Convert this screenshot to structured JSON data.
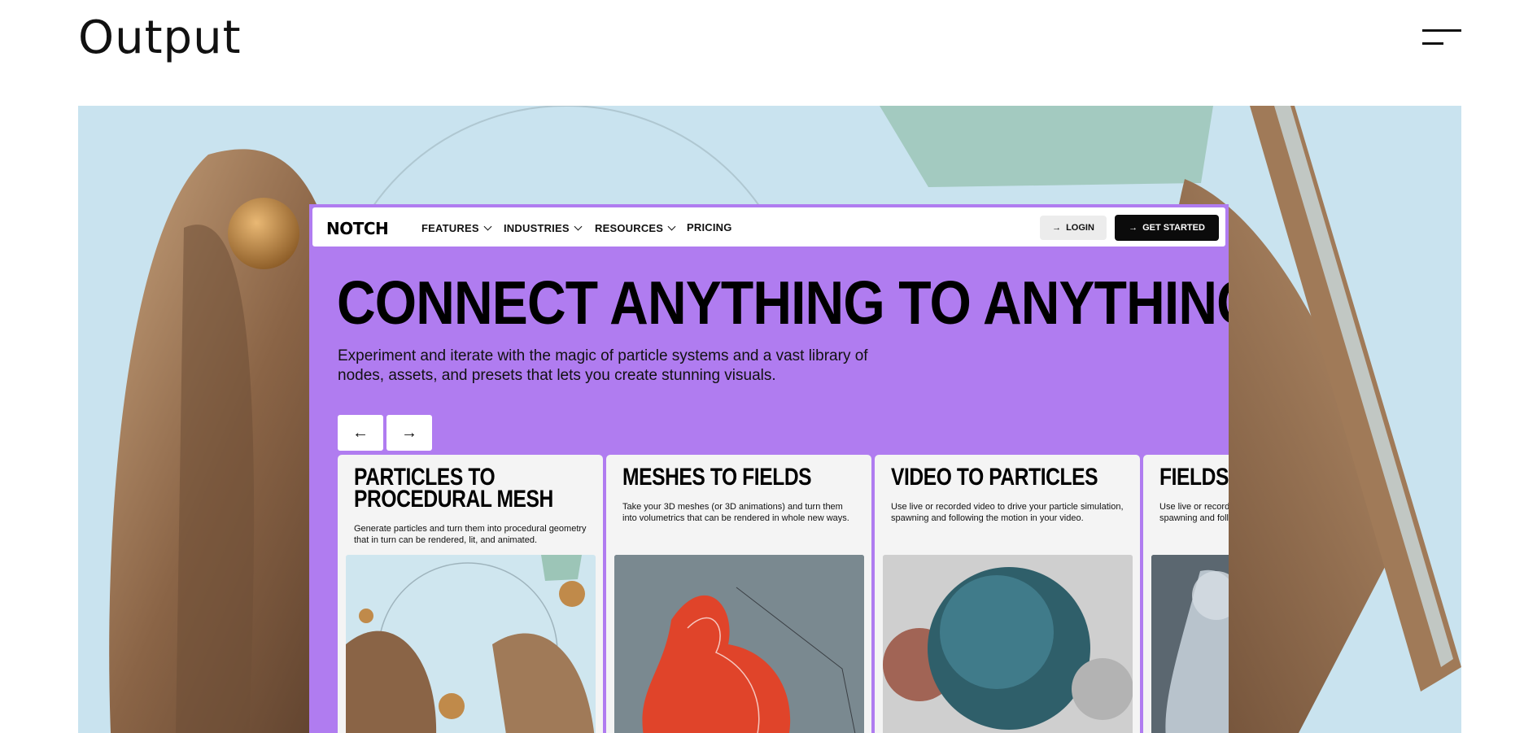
{
  "page": {
    "title": "Output",
    "menu_icon": "hamburger-menu-icon"
  },
  "mockup": {
    "logo": "NOTCH",
    "nav": [
      {
        "label": "FEATURES",
        "has_dropdown": true
      },
      {
        "label": "INDUSTRIES",
        "has_dropdown": true
      },
      {
        "label": "RESOURCES",
        "has_dropdown": true
      },
      {
        "label": "PRICING",
        "has_dropdown": false
      }
    ],
    "login_label": "LOGIN",
    "get_started_label": "GET STARTED",
    "headline": "CONNECT ANYTHING TO ANYTHING",
    "subtitle": "Experiment and iterate with the magic of particle systems and a vast library of nodes, assets, and presets that lets you create stunning visuals.",
    "prev_icon": "arrow-left-icon",
    "next_icon": "arrow-right-icon",
    "cards": [
      {
        "title": "PARTICLES TO PROCEDURAL MESH",
        "title_line1": "PARTICLES TO",
        "title_line2": "PROCEDURAL MESH",
        "description": "Generate particles and turn them into procedural geometry that in turn can be rendered, lit, and animated."
      },
      {
        "title": "MESHES TO FIELDS",
        "description": "Take your 3D meshes (or 3D animations) and turn them into volumetrics that can be rendered in whole new ways."
      },
      {
        "title": "VIDEO TO PARTICLES",
        "description": "Use live or recorded video to drive your particle simulation, spawning and following the motion in your video."
      },
      {
        "title": "FIELDS TO",
        "description": "Use live or recorded video to drive your particle simulation, spawning and following the motion in your video."
      }
    ]
  },
  "colors": {
    "accent": "#b07cf0",
    "hero_bg": "#c9e3ef",
    "button_dark": "#0b0b0b"
  }
}
